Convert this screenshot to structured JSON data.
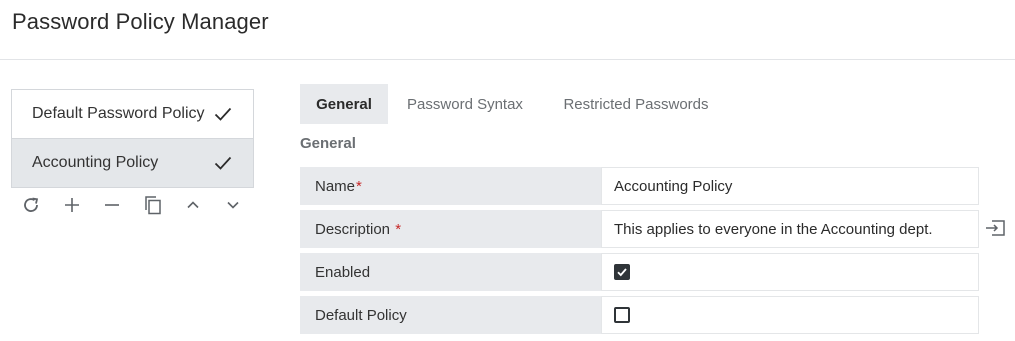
{
  "header": {
    "title": "Password Policy Manager"
  },
  "policies": {
    "items": [
      {
        "label": "Default Password Policy",
        "selected": false,
        "checkmark": true
      },
      {
        "label": "Accounting Policy",
        "selected": true,
        "checkmark": true
      }
    ],
    "toolbar": [
      {
        "icon": "refresh-icon"
      },
      {
        "icon": "add-icon"
      },
      {
        "icon": "remove-icon"
      },
      {
        "icon": "copy-icon"
      },
      {
        "icon": "move-up-icon"
      },
      {
        "icon": "move-down-icon"
      }
    ]
  },
  "tabs": [
    {
      "label": "General",
      "active": true
    },
    {
      "label": "Password Syntax",
      "active": false
    },
    {
      "label": "Restricted Passwords",
      "active": false
    }
  ],
  "section": {
    "heading": "General"
  },
  "form": {
    "name": {
      "label": "Name",
      "required_mark": "*",
      "value": "Accounting Policy"
    },
    "description": {
      "label": "Description ",
      "required_mark": "*",
      "value": "This applies to everyone in the Accounting dept."
    },
    "enabled": {
      "label": "Enabled",
      "checked": true
    },
    "default_policy": {
      "label": "Default Policy",
      "checked": false
    }
  },
  "colors": {
    "selected_row": "#e4e7ea",
    "active_tab": "#e8eaed",
    "label_cell": "#e8eaed",
    "required": "#c62828"
  }
}
